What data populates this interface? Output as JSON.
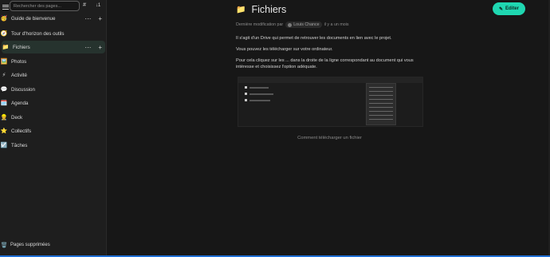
{
  "sidebar": {
    "search_placeholder": "Rechercher des pages...",
    "hash_label": "#",
    "sort_label": "↓1",
    "collective": {
      "emoji": "🥳",
      "label": "Guide de bienvenue"
    },
    "items": [
      {
        "emoji": "🧭",
        "label": "Tour d'horizon des outils"
      },
      {
        "emoji": "📁",
        "label": "Fichiers"
      },
      {
        "emoji": "🖼️",
        "label": "Photos"
      },
      {
        "emoji": "⚡",
        "label": "Activité"
      },
      {
        "emoji": "💬",
        "label": "Discussion"
      },
      {
        "emoji": "🗓️",
        "label": "Agenda"
      },
      {
        "emoji": "👷",
        "label": "Deck"
      },
      {
        "emoji": "⭐",
        "label": "Collectifs"
      },
      {
        "emoji": "☑️",
        "label": "Tâches"
      }
    ],
    "actions": {
      "more": "⋯",
      "add": "+"
    },
    "trash": {
      "emoji": "🗑️",
      "label": "Pages supprimées"
    }
  },
  "page": {
    "emoji": "📁",
    "title": "Fichiers",
    "edit_label": "Editer",
    "edit_icon": "✎",
    "meta_prefix": "Dernière modification par",
    "author": "Louis Chance",
    "meta_time": "il y a un mois",
    "paragraphs": [
      "Il s'agit d'un Drive qui permet de retrouver les documents en lien avec le projet.",
      "Vous pouvez les télécharger sur votre ordinateur.",
      "Pour cela cliquez sur les ... dans la droite de la ligne correspondant au document qui vous intéresse et choisissez l'option adéquate."
    ],
    "image_caption": "Comment télécharger un fichier"
  }
}
